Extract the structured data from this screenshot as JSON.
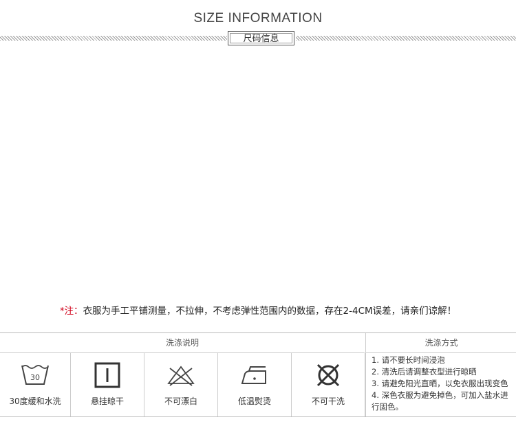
{
  "header": {
    "title": "SIZE INFORMATION",
    "subtitle": "尺码信息"
  },
  "note": {
    "prefix": "*注：",
    "text": "衣服为手工平铺测量，不拉伸，不考虑弹性范围内的数据，存在2-4CM误差，请亲们谅解！"
  },
  "care": {
    "section_left_title": "洗涤说明",
    "section_right_title": "洗涤方式",
    "symbols": [
      {
        "icon": "washtub-30-icon",
        "number": "30",
        "label": "30度缓和水洗"
      },
      {
        "icon": "hang-dry-icon",
        "label": "悬挂晾干"
      },
      {
        "icon": "no-bleach-icon",
        "label": "不可漂白"
      },
      {
        "icon": "low-iron-icon",
        "label": "低温熨烫"
      },
      {
        "icon": "no-dry-clean-icon",
        "label": "不可干洗"
      }
    ],
    "instructions": [
      "1. 请不要长时间浸泡",
      "2. 清洗后请调整衣型进行晾晒",
      "3. 请避免阳光直晒，以免衣服出现变色",
      "4. 深色衣服为避免掉色，可加入盐水进",
      "行固色。"
    ]
  }
}
